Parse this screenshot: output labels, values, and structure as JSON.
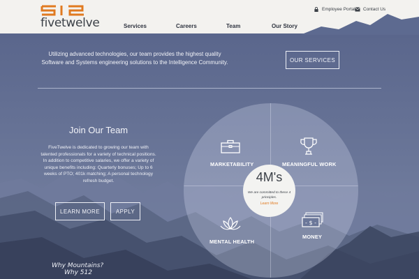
{
  "brand": {
    "logo_mark": "512",
    "logo_text": "fivetwelve",
    "orange": "#e07a20"
  },
  "utility": {
    "employee_portal": {
      "label": "Employee Portal",
      "icon": "lock-icon"
    },
    "contact_us": {
      "label": "Contact Us",
      "icon": "envelope-icon"
    }
  },
  "nav": {
    "items": [
      "Services",
      "Careers",
      "Team",
      "Our Story"
    ]
  },
  "intro": {
    "text": "Utilizing advanced technologies, our team provides the highest quality Software and Systems engineering solutions to the Intelligence Community.",
    "button": "OUR SERVICES"
  },
  "join": {
    "title": "Join Our Team",
    "text": "FiveTwelve is dedicated to growing our team with talented professionals for a variety of technical positions. In addition to competitive salaries, we offer a variety of unique benefits including: Quarterly bonuses; Up to 6 weeks of PTO; 401k matching; A personal technology refresh budget.",
    "learn_more": "LEARN MORE",
    "apply": "APPLY"
  },
  "principles": {
    "center_title": "4M's",
    "center_text": "We are committed to these 4 principles.",
    "center_link": "Learn More",
    "items": [
      {
        "label": "MARKETABILITY",
        "icon": "briefcase-icon"
      },
      {
        "label": "MEANINGFUL WORK",
        "icon": "trophy-icon"
      },
      {
        "label": "MENTAL HEALTH",
        "icon": "lotus-icon"
      },
      {
        "label": "MONEY",
        "icon": "money-icon"
      }
    ]
  },
  "why": {
    "line1": "Why Mountains?",
    "line2": "Why 512"
  }
}
